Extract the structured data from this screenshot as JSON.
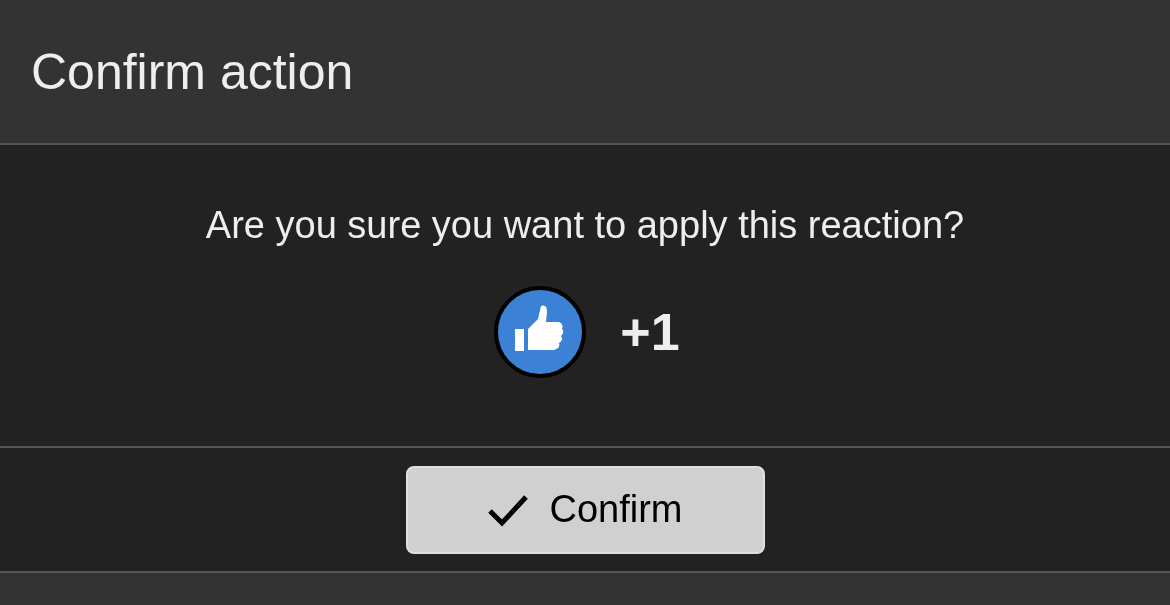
{
  "dialog": {
    "title": "Confirm action",
    "message": "Are you sure you want to apply this reaction?",
    "reaction": {
      "label": "+1"
    },
    "buttons": [
      {
        "kind": "confirm",
        "label": "Confirm"
      }
    ]
  }
}
